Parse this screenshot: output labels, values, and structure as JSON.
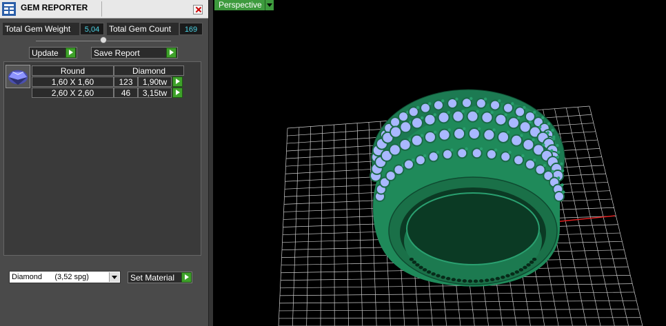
{
  "window": {
    "title": "GEM REPORTER"
  },
  "stats": {
    "weight_label": "Total Gem Weight",
    "weight_value": "5,04",
    "count_label": "Total Gem Count",
    "count_value": "169"
  },
  "buttons": {
    "update": "Update",
    "save_report": "Save Report",
    "set_material": "Set Material"
  },
  "table": {
    "headers": [
      "Round",
      "Diamond"
    ],
    "rows": [
      {
        "size": "1,60 X 1,60",
        "count": "123",
        "weight": "1,90tw"
      },
      {
        "size": "2,60 X 2,60",
        "count": "46",
        "weight": "3,15tw"
      }
    ]
  },
  "material": {
    "selected": "Diamond      (3,52 spg)"
  },
  "viewport": {
    "tab": "Perspective"
  },
  "colors": {
    "metal": "#1f8a5a",
    "gem": "#a9b8ff",
    "grid": "#cfcfcf",
    "accent_green": "#3ea12a"
  }
}
